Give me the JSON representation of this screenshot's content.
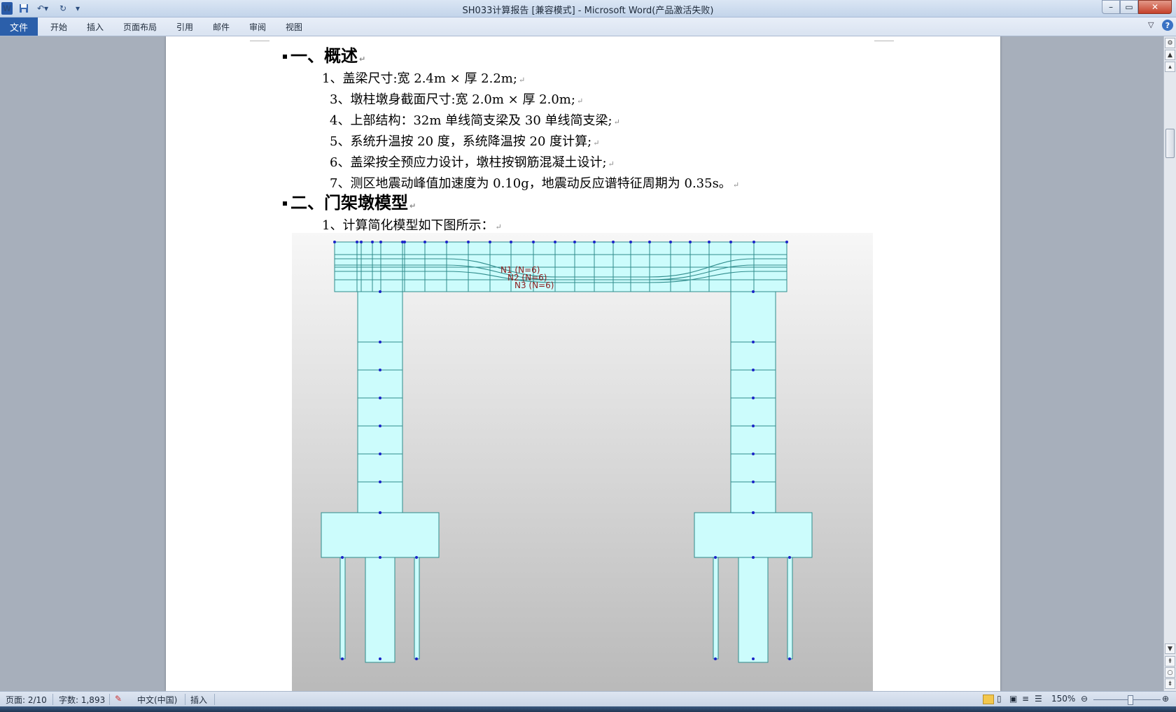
{
  "window": {
    "title": "SH033计算报告 [兼容模式] - Microsoft Word(产品激活失败)",
    "quick_access": [
      "word-icon",
      "save-icon",
      "undo-icon",
      "redo-icon",
      "customize-icon"
    ]
  },
  "ribbon": {
    "file_tab": "文件",
    "tabs": [
      "开始",
      "插入",
      "页面布局",
      "引用",
      "邮件",
      "审阅",
      "视图"
    ]
  },
  "document": {
    "heading1": "一、概述",
    "items": [
      "1、盖梁尺寸:宽 2.4m × 厚  2.2m;",
      "3、墩柱墩身截面尺寸:宽 2.0m × 厚  2.0m;",
      "4、上部结构：32m 单线简支梁及 30 单线简支梁;",
      "5、系统升温按 20 度，系统降温按 20 度计算;",
      "6、盖梁按全预应力设计，墩柱按钢筋混凝土设计;",
      "7、测区地震动峰值加速度为 0.10g，地震动反应谱特征周期为 0.35s。"
    ],
    "heading2": "二、门架墩模型",
    "item_model": "1、计算简化模型如下图所示：",
    "model_labels": [
      "N1 (N=6)",
      "N2 (N=6)",
      "N3 (N=6)"
    ]
  },
  "statusbar": {
    "page": "页面: 2/10",
    "words": "字数: 1,893",
    "language": "中文(中国)",
    "mode": "插入",
    "zoom": "150%"
  },
  "colors": {
    "accent": "#2b5faa",
    "mesh_fill": "#ccfcfc",
    "mesh_line": "#2f8c8c",
    "node": "#1a24c8",
    "tendon_label": "#8b1a1a"
  }
}
